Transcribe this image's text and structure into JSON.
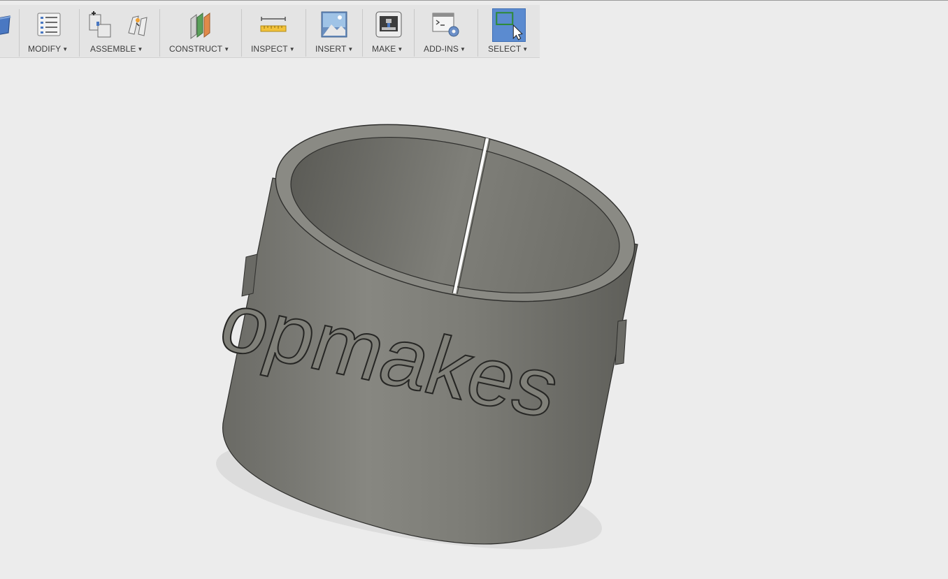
{
  "toolbar": {
    "groups": [
      {
        "label": "MODIFY",
        "icon": "modify-icon"
      },
      {
        "label": "ASSEMBLE",
        "icon": "assemble-icon"
      },
      {
        "label": "CONSTRUCT",
        "icon": "construct-icon"
      },
      {
        "label": "INSPECT",
        "icon": "inspect-icon"
      },
      {
        "label": "INSERT",
        "icon": "insert-icon"
      },
      {
        "label": "MAKE",
        "icon": "make-icon"
      },
      {
        "label": "ADD-INS",
        "icon": "add-ins-icon"
      },
      {
        "label": "SELECT",
        "icon": "select-icon"
      }
    ],
    "caret": "▼"
  },
  "model": {
    "embossed_text": "opmakes"
  },
  "colors": {
    "canvas": "#ececec",
    "toolbar": "#e4e4e4",
    "model": "#7b7b74",
    "select_active": "#5b8bd0"
  }
}
